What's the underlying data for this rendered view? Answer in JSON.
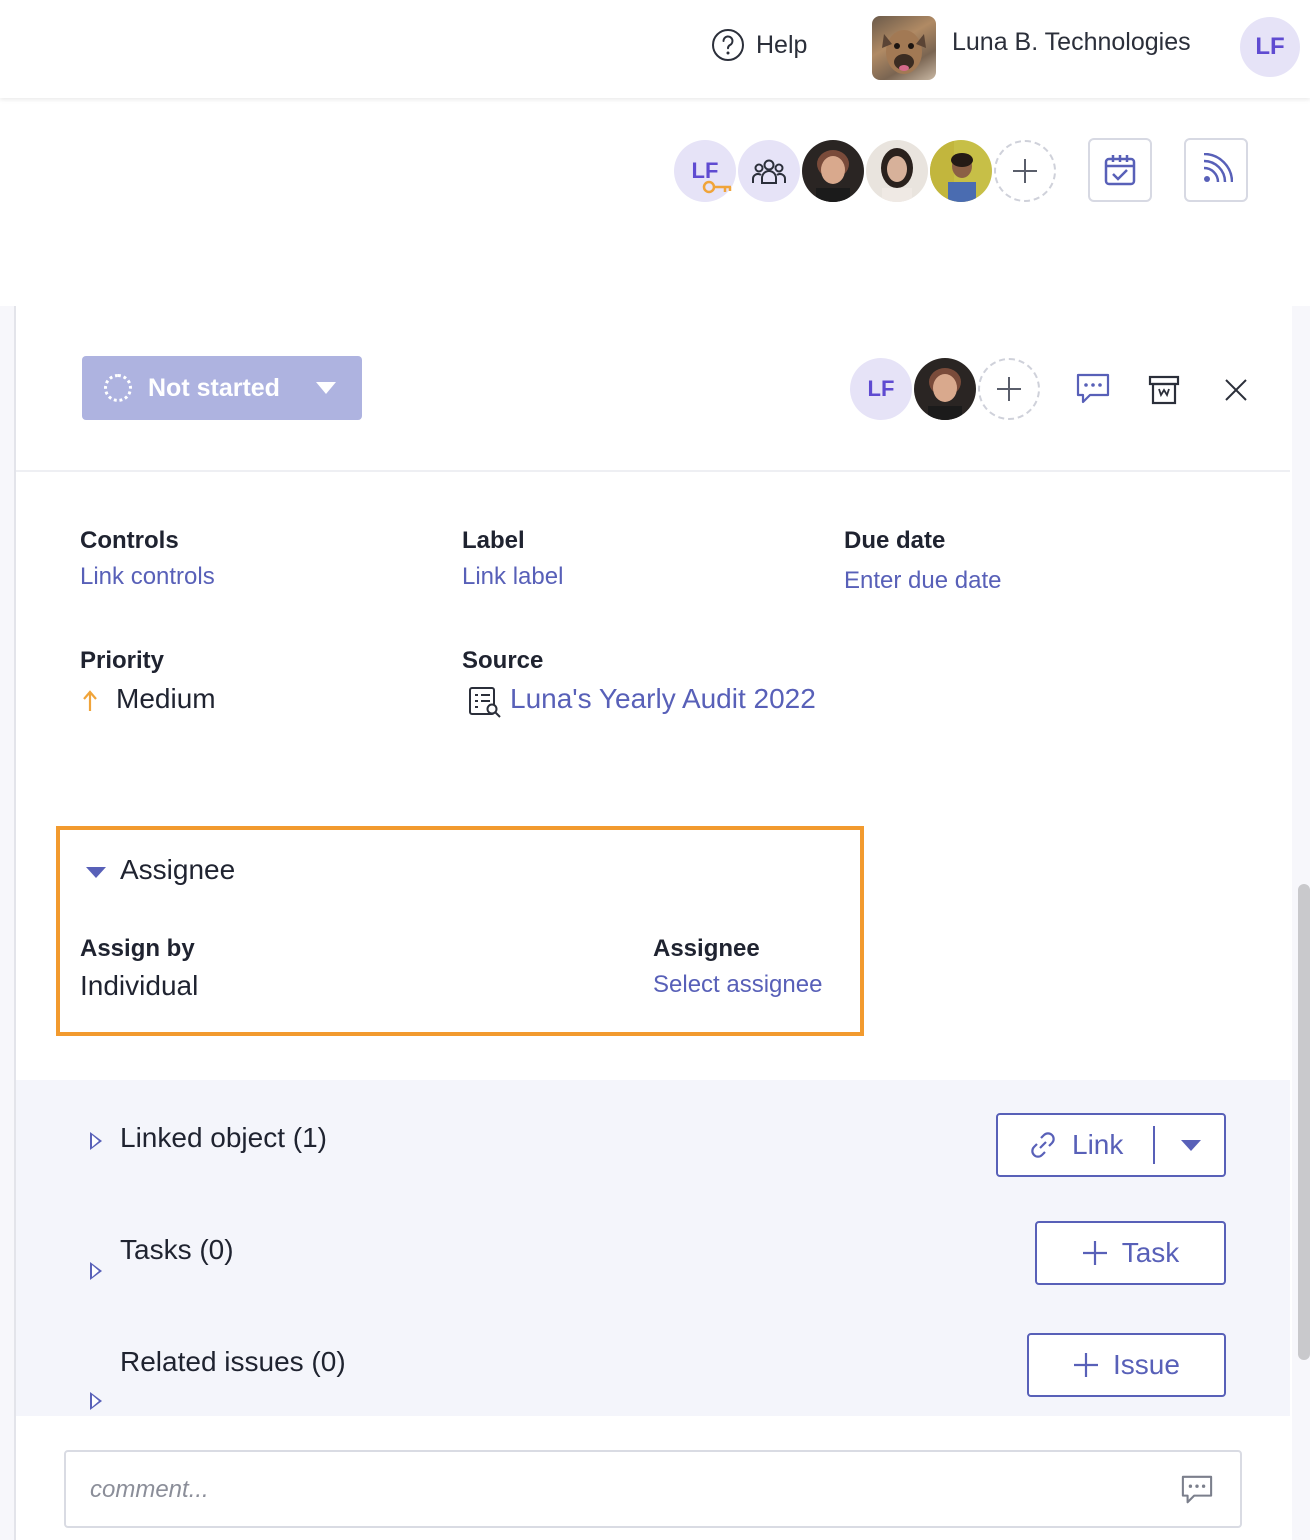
{
  "header": {
    "help_label": "Help",
    "org_name": "Luna B. Technologies",
    "user_initials": "LF"
  },
  "collaborators": {
    "owner_initials": "LF"
  },
  "issue": {
    "status": "Not started",
    "assignee_initials": "LF"
  },
  "fields": {
    "controls_label": "Controls",
    "controls_value": "Link controls",
    "label_label": "Label",
    "label_value": "Link label",
    "due_label": "Due date",
    "due_value": "Enter due date",
    "priority_label": "Priority",
    "priority_value": "Medium",
    "source_label": "Source",
    "source_value": "Luna's Yearly Audit 2022"
  },
  "assignee_section": {
    "title": "Assignee",
    "assign_by_label": "Assign by",
    "assign_by_value": "Individual",
    "assignee_label": "Assignee",
    "assignee_value": "Select assignee"
  },
  "linked_object": {
    "title": "Linked object (1)",
    "button": "Link"
  },
  "tasks": {
    "title": "Tasks (0)",
    "button": "Task"
  },
  "related_issues": {
    "title": "Related issues (0)",
    "button": "Issue"
  },
  "comment": {
    "placeholder": "comment..."
  },
  "colors": {
    "accent": "#5860b8",
    "highlight": "#f29a2e",
    "status_bg": "#aeb3e0",
    "priority_arrow": "#f0a43a"
  }
}
